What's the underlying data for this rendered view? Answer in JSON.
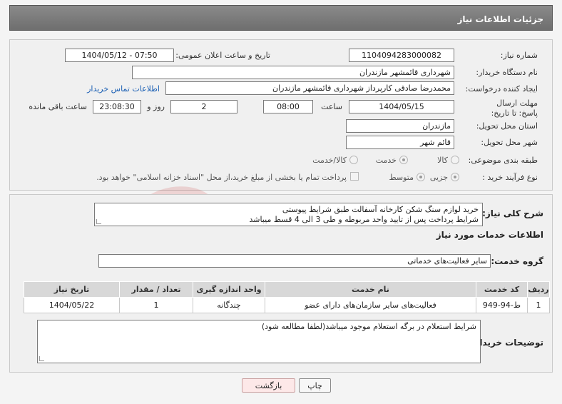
{
  "header": {
    "title": "جزئیات اطلاعات نیاز"
  },
  "need": {
    "number_label": "شماره نیاز:",
    "number_value": "1104094283000082",
    "announce_label": "تاریخ و ساعت اعلان عمومی:",
    "announce_value": "1404/05/12 - 07:50",
    "buyer_label": "نام دستگاه خریدار:",
    "buyer_value": "شهرداری قائمشهر مازندران",
    "creator_label": "ایجاد کننده درخواست:",
    "creator_value": "محمدرضا صادقی کارپرداز شهرداری قائمشهر مازندران",
    "contact_link": "اطلاعات تماس خریدار",
    "deadline_label": "مهلت ارسال پاسخ: تا تاریخ:",
    "deadline_date": "1404/05/15",
    "time_label": "ساعت",
    "deadline_time": "08:00",
    "days_value": "2",
    "days_label": "روز و",
    "remaining_value": "23:08:30",
    "remaining_label": "ساعت باقی مانده",
    "province_label": "استان محل تحویل:",
    "province_value": "مازندران",
    "city_label": "شهر محل تحویل:",
    "city_value": "قائم شهر",
    "category_label": "طبقه بندی موضوعی:",
    "category_options": [
      "کالا",
      "خدمت",
      "کالا/خدمت"
    ],
    "category_selected": "خدمت",
    "process_label": "نوع فرآیند خرید :",
    "process_options": [
      "جزیی",
      "متوسط"
    ],
    "process_selected": "جزیی",
    "payment_note": "پرداخت تمام یا بخشی از مبلغ خرید،از محل \"اسناد خزانه اسلامی\" خواهد بود."
  },
  "details": {
    "summary_label": "شرح کلی نیاز:",
    "summary_lines": [
      "خرید لوازم سنگ شکن کارخانه آسفالت طبق شرایط پیوستی",
      "شرایط پرداخت پس از تایید واحد مربوطه و طی 3 الی 4 قسط میباشد"
    ],
    "services_heading": "اطلاعات خدمات مورد نیاز",
    "service_group_label": "گروه خدمت:",
    "service_group_value": "سایر فعالیت‌های خدماتی",
    "table": {
      "headers": [
        "ردیف",
        "کد خدمت",
        "نام خدمت",
        "واحد اندازه گیری",
        "تعداد / مقدار",
        "تاریخ نیاز"
      ],
      "rows": [
        [
          "1",
          "ط-94-949",
          "فعالیت‌های سایر سازمان‌های دارای عضو",
          "چندگانه",
          "1",
          "1404/05/22"
        ]
      ]
    },
    "buyer_notes_label": "توضیحات خریدار:",
    "buyer_notes_value": "شرایط استعلام در برگه استعلام موجود میباشد(لطفا مطالعه شود)"
  },
  "buttons": {
    "print": "چاپ",
    "back": "بازگشت"
  }
}
